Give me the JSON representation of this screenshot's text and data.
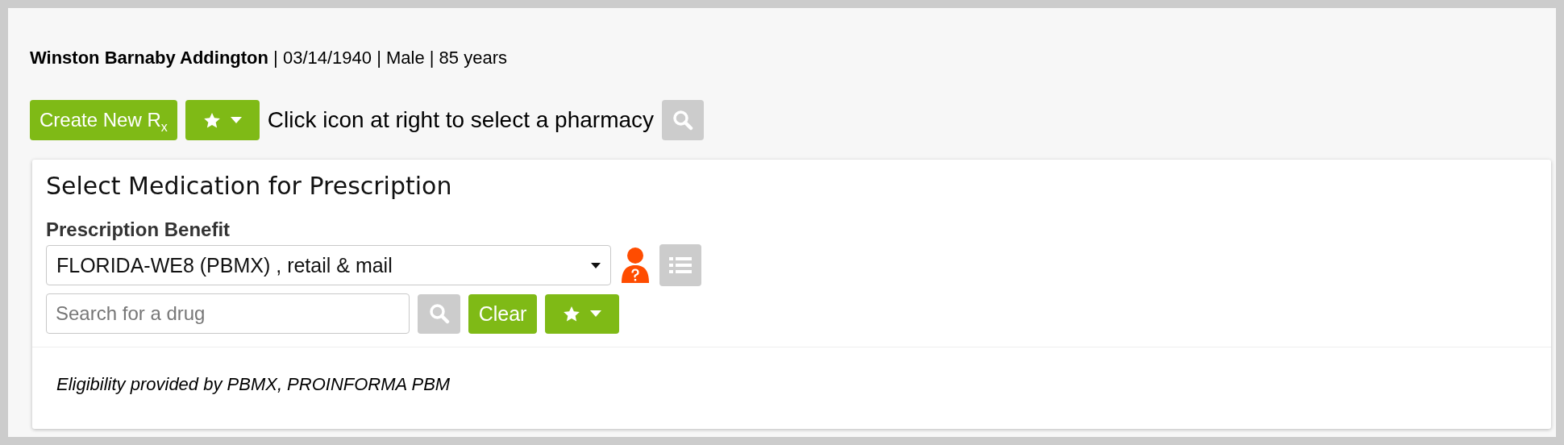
{
  "patient": {
    "summary": "**Winston Barnaby Addington** | 03/14/1940 | Male | 85 years"
  },
  "toolbar": {
    "create_button": "Create New R$_{x}$",
    "pharmacy_hint": "Click icon at right to select a pharmacy"
  },
  "medication_panel": {
    "title": "Select Medication for Prescription",
    "benefit_label": "Prescription Benefit",
    "benefit_value": "FLORIDA-WE8 (PBMX) , retail & mail",
    "search": {
      "placeholder": "Search for a drug"
    },
    "clear_button": "Clear",
    "eligibility_note": "Eligibility provided by PBMX, PROINFORMA PBM"
  }
}
